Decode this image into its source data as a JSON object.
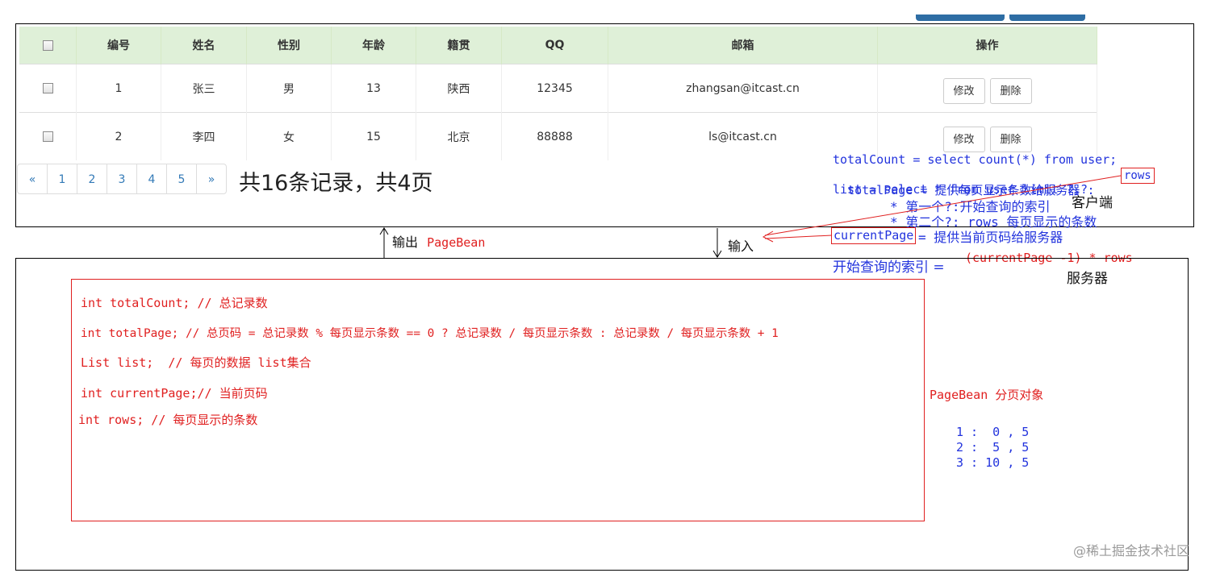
{
  "table": {
    "headers": [
      "编号",
      "姓名",
      "性别",
      "年龄",
      "籍贯",
      "QQ",
      "邮箱",
      "操作"
    ],
    "rows": [
      {
        "id": "1",
        "name": "张三",
        "gender": "男",
        "age": "13",
        "hometown": "陕西",
        "qq": "12345",
        "email": "zhangsan@itcast.cn"
      },
      {
        "id": "2",
        "name": "李四",
        "gender": "女",
        "age": "15",
        "hometown": "北京",
        "qq": "88888",
        "email": "ls@itcast.cn"
      }
    ],
    "edit_label": "修改",
    "delete_label": "删除"
  },
  "pagination": {
    "prev": "«",
    "pages": [
      "1",
      "2",
      "3",
      "4",
      "5"
    ],
    "next": "»",
    "summary": "共16条记录，共4页"
  },
  "client_notes": {
    "line1": "totalCount = select count(*) from user;",
    "line2_prefix": "totalPage = 提供每页显示条数给服务器 :",
    "rows_label": "rows",
    "line3": "list = select * from user limit ?,?",
    "line4": "* 第一个?:开始查询的索引",
    "line5": "* 第二个?: rows 每页显示的条数",
    "current_page_label": "currentPage",
    "line6_suffix": "= 提供当前页码给服务器",
    "line7_prefix": "开始查询的索引 =",
    "line7_formula": "(currentPage -1) * rows",
    "client_label": "客户端",
    "server_label": "服务器"
  },
  "flow": {
    "output_label": "输出",
    "output_type": "PageBean",
    "input_label": "输入"
  },
  "pagebean": {
    "fields": [
      "int totalCount; // 总记录数",
      "int totalPage; // 总页码 = 总记录数 % 每页显示条数 == 0 ? 总记录数 / 每页显示条数 : 总记录数 / 每页显示条数 + 1",
      "List list;  // 每页的数据 list集合",
      "int currentPage;// 当前页码",
      "int rows; // 每页显示的条数"
    ],
    "caption": "PageBean 分页对象",
    "examples": [
      "1 :  0 , 5",
      "2 :  5 , 5",
      "3 : 10 , 5"
    ]
  },
  "watermark": "@稀土掘金技术社区"
}
